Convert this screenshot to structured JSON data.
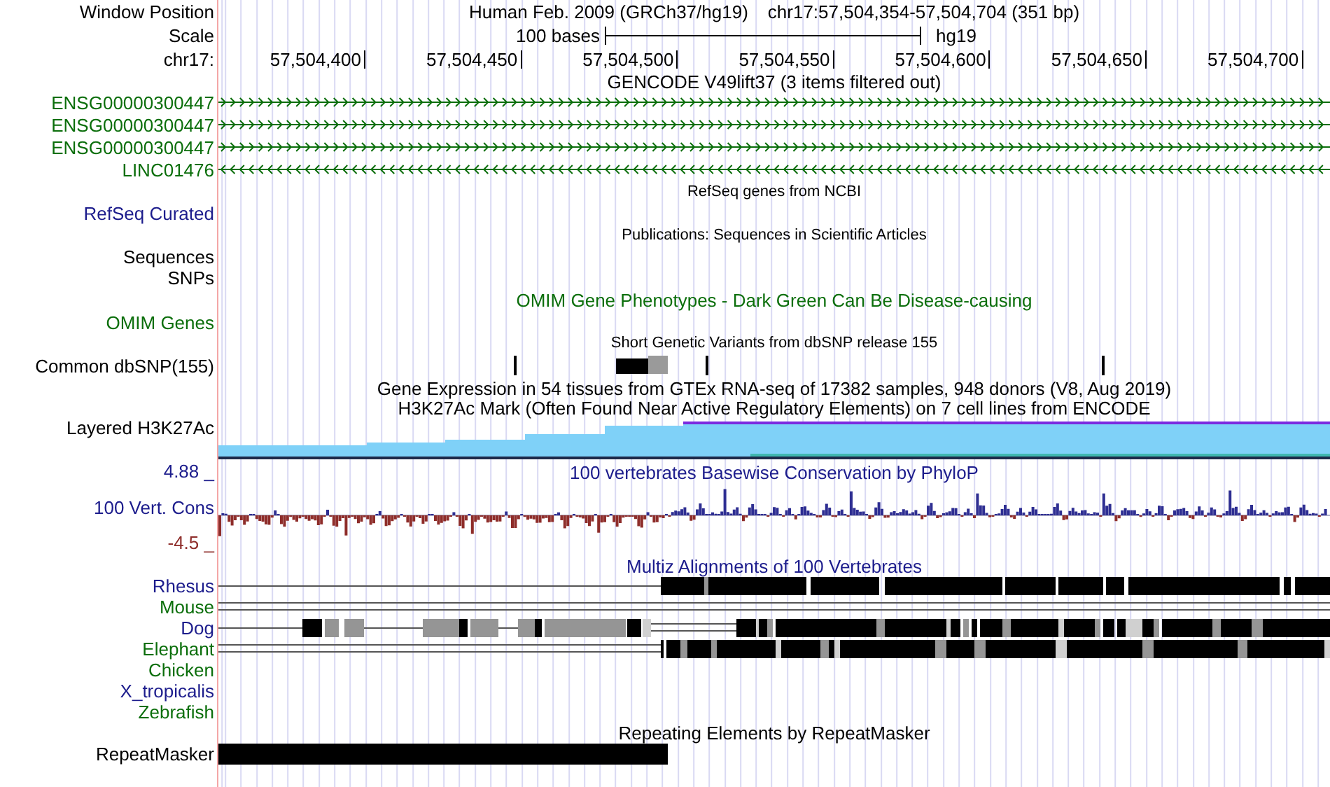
{
  "header": {
    "position_label": "Window Position",
    "assembly": "Human Feb. 2009 (GRCh37/hg19)",
    "position": "chr17:57,504,354-57,504,704 (351 bp)",
    "scale_label": "Scale",
    "scale_text": "100 bases",
    "scale_db": "hg19",
    "chrom_label": "chr17:",
    "ticks": [
      "57,504,400",
      "57,504,450",
      "57,504,500",
      "57,504,550",
      "57,504,600",
      "57,504,650",
      "57,504,700"
    ]
  },
  "tracks": [
    {
      "kind": "genes",
      "title": "GENCODE V49lift37 (3 items filtered out)",
      "color": "#000000",
      "rows": [
        {
          "label": "ENSG00000300447",
          "color": "#0b6e0b",
          "reverse": false
        },
        {
          "label": "ENSG00000300447",
          "color": "#0b6e0b",
          "reverse": false
        },
        {
          "label": "ENSG00000300447",
          "color": "#0b6e0b",
          "reverse": false
        },
        {
          "label": "LINC01476",
          "color": "#0b6e0b",
          "reverse": true
        }
      ]
    },
    {
      "kind": "empty",
      "title": "RefSeq genes from NCBI",
      "color": "#000000",
      "rows": [
        {
          "label": "RefSeq Curated",
          "color": "#1c1c8c"
        }
      ]
    },
    {
      "kind": "empty",
      "title": "Publications: Sequences in Scientific Articles",
      "color": "#000000",
      "rows": [
        {
          "label": "Sequences",
          "color": "#000000"
        },
        {
          "label": "SNPs",
          "color": "#000000"
        }
      ]
    },
    {
      "kind": "omim",
      "title": "OMIM Gene Phenotypes - Dark Green Can Be Disease-causing",
      "color": "#0b6e0b",
      "rows": [
        {
          "label": "OMIM Genes",
          "color": "#0b6e0b"
        }
      ]
    },
    {
      "kind": "snps",
      "title": "Short Genetic Variants from dbSNP release 155",
      "color": "#000000",
      "rows": [
        {
          "label": "Common dbSNP(155)",
          "color": "#000000"
        }
      ]
    },
    {
      "kind": "title",
      "title": "Gene Expression in 54 tissues from GTEx RNA-seq of 17382 samples, 948 donors (V8, Aug 2019)",
      "color": "#000000"
    },
    {
      "kind": "layered",
      "title": "H3K27Ac Mark (Often Found Near Active Regulatory Elements) on 7 cell lines from ENCODE",
      "color": "#000000",
      "rows": [
        {
          "label": "Layered H3K27Ac",
          "color": "#000000"
        }
      ]
    },
    {
      "kind": "wiggle",
      "title": "100 vertebrates Basewise Conservation by PhyloP",
      "color": "#1c1c8c",
      "axis": {
        "max": "4.88 _",
        "min": "-4.5 _"
      },
      "rows": [
        {
          "label": "100 Vert. Cons",
          "color": "#1c1c8c"
        }
      ]
    },
    {
      "kind": "alignment",
      "title": "Multiz Alignments of 100 Vertebrates",
      "color": "#1c1c8c",
      "rows": [
        {
          "label": "Rhesus",
          "color": "#1c1c8c"
        },
        {
          "label": "Mouse",
          "color": "#0b6e0b"
        },
        {
          "label": "Dog",
          "color": "#1c1c8c"
        },
        {
          "label": "Elephant",
          "color": "#0b6e0b"
        },
        {
          "label": "Chicken",
          "color": "#0b6e0b"
        },
        {
          "label": "X_tropicalis",
          "color": "#1c1c8c"
        },
        {
          "label": "Zebrafish",
          "color": "#0b6e0b"
        }
      ]
    },
    {
      "kind": "repeats",
      "title": "Repeating Elements by RepeatMasker",
      "color": "#000000",
      "rows": [
        {
          "label": "RepeatMasker",
          "color": "#000000"
        }
      ]
    }
  ]
}
